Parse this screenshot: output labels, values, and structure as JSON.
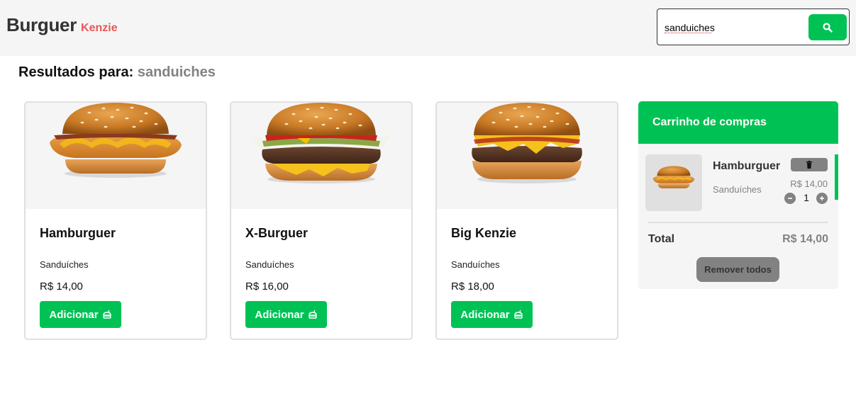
{
  "brand": {
    "main": "Burguer",
    "sub": "Kenzie"
  },
  "search": {
    "value": "sanduiches",
    "button_icon": "search-icon"
  },
  "results": {
    "label": "Resultados para:",
    "term": "sanduiches"
  },
  "products": [
    {
      "name": "Hamburguer",
      "category": "Sanduíches",
      "price": "R$ 14,00",
      "button": "Adicionar"
    },
    {
      "name": "X-Burguer",
      "category": "Sanduíches",
      "price": "R$ 16,00",
      "button": "Adicionar"
    },
    {
      "name": "Big Kenzie",
      "category": "Sanduíches",
      "price": "R$ 18,00",
      "button": "Adicionar"
    }
  ],
  "cart": {
    "title": "Carrinho de compras",
    "items": [
      {
        "name": "Hamburguer",
        "category": "Sanduíches",
        "price": "R$ 14,00",
        "quantity": "1"
      }
    ],
    "total_label": "Total",
    "total_value": "R$ 14,00",
    "remove_all": "Remover todos"
  },
  "colors": {
    "primary": "#00c254",
    "brand_accent": "#eb5757",
    "gray": "#828282",
    "light_bg": "#f5f5f5"
  }
}
